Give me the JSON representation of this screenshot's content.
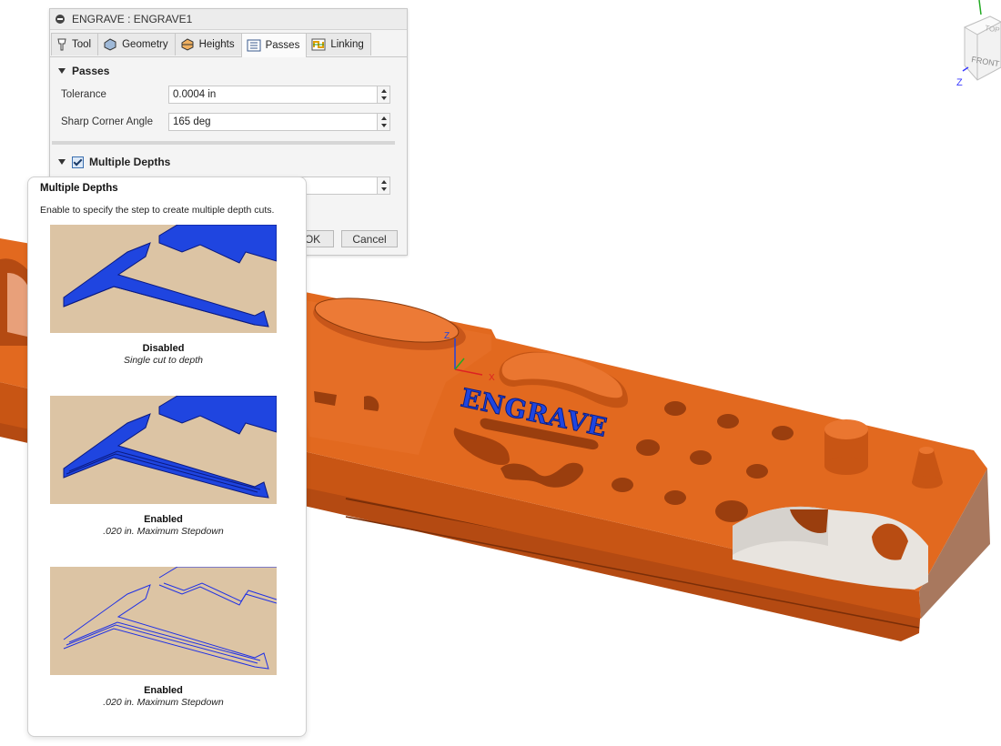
{
  "dialog": {
    "title": "ENGRAVE : ENGRAVE1",
    "tabs": [
      {
        "label": "Tool",
        "icon": "tool-icon"
      },
      {
        "label": "Geometry",
        "icon": "geometry-icon"
      },
      {
        "label": "Heights",
        "icon": "heights-icon"
      },
      {
        "label": "Passes",
        "icon": "passes-icon",
        "active": true
      },
      {
        "label": "Linking",
        "icon": "linking-icon"
      }
    ],
    "passes_section": "Passes",
    "tolerance": {
      "label": "Tolerance",
      "value": "0.0004 in"
    },
    "sharp_corner": {
      "label": "Sharp Corner Angle",
      "value": "165 deg"
    },
    "multiple_depths": {
      "label": "Multiple Depths",
      "checked": true
    },
    "ok_label": "OK",
    "cancel_label": "Cancel"
  },
  "tooltip": {
    "title": "Multiple Depths",
    "description": "Enable to specify the step to create multiple depth cuts.",
    "items": [
      {
        "caption": "Disabled",
        "subcaption": "Single cut to depth"
      },
      {
        "caption": "Enabled",
        "subcaption": ".020 in. Maximum Stepdown"
      },
      {
        "caption": "Enabled",
        "subcaption": ".020 in. Maximum Stepdown"
      }
    ]
  },
  "viewcube": {
    "top": "TOP",
    "front": "FRONT",
    "axis_z": "Z"
  },
  "model": {
    "engrave_text": "ENGRAVE",
    "triad_x": "X",
    "triad_z": "Z"
  },
  "colors": {
    "part": "#e2691f",
    "engrave": "#1f45e0",
    "stock": "#dcc4a4",
    "toolpath": "#1e30e6"
  }
}
